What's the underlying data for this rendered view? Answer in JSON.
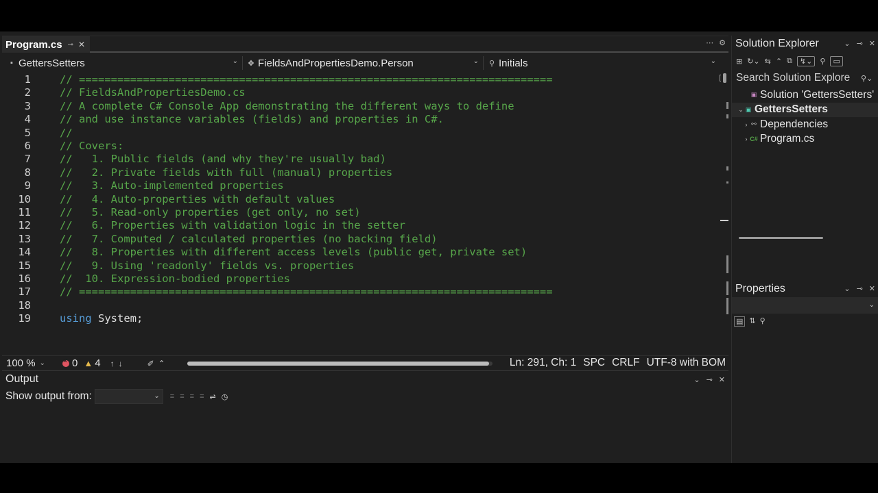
{
  "editor": {
    "tab": {
      "title": "Program.cs",
      "pin_icon": "pin-icon",
      "close_icon": "close-icon"
    },
    "nav": {
      "project": "GettersSetters",
      "type": "FieldsAndPropertiesDemo.Person",
      "member": "Initials"
    },
    "lines": [
      {
        "n": "1",
        "parts": [
          {
            "t": "// ==========================================================================",
            "c": "cm"
          }
        ]
      },
      {
        "n": "2",
        "parts": [
          {
            "t": "// FieldsAndPropertiesDemo.cs",
            "c": "cm"
          }
        ]
      },
      {
        "n": "3",
        "parts": [
          {
            "t": "// A complete C# Console App demonstrating the different ways to define",
            "c": "cm"
          }
        ]
      },
      {
        "n": "4",
        "parts": [
          {
            "t": "// and use instance variables (fields) and properties in C#.",
            "c": "cm"
          }
        ]
      },
      {
        "n": "5",
        "parts": [
          {
            "t": "//",
            "c": "cm"
          }
        ]
      },
      {
        "n": "6",
        "parts": [
          {
            "t": "// Covers:",
            "c": "cm"
          }
        ]
      },
      {
        "n": "7",
        "parts": [
          {
            "t": "//   1. Public fields (and why they're usually bad)",
            "c": "cm"
          }
        ]
      },
      {
        "n": "8",
        "parts": [
          {
            "t": "//   2. Private fields with full (manual) properties",
            "c": "cm"
          }
        ]
      },
      {
        "n": "9",
        "parts": [
          {
            "t": "//   3. Auto-implemented properties",
            "c": "cm"
          }
        ]
      },
      {
        "n": "10",
        "parts": [
          {
            "t": "//   4. Auto-properties with default values",
            "c": "cm"
          }
        ]
      },
      {
        "n": "11",
        "parts": [
          {
            "t": "//   5. Read-only properties (get only, no set)",
            "c": "cm"
          }
        ]
      },
      {
        "n": "12",
        "parts": [
          {
            "t": "//   6. Properties with validation logic in the setter",
            "c": "cm"
          }
        ]
      },
      {
        "n": "13",
        "parts": [
          {
            "t": "//   7. Computed / calculated properties (no backing field)",
            "c": "cm"
          }
        ]
      },
      {
        "n": "14",
        "parts": [
          {
            "t": "//   8. Properties with different access levels (public get, private set)",
            "c": "cm"
          }
        ]
      },
      {
        "n": "15",
        "parts": [
          {
            "t": "//   9. Using 'readonly' fields vs. properties",
            "c": "cm"
          }
        ]
      },
      {
        "n": "16",
        "parts": [
          {
            "t": "//  10. Expression-bodied properties",
            "c": "cm"
          }
        ]
      },
      {
        "n": "17",
        "parts": [
          {
            "t": "// ==========================================================================",
            "c": "cm"
          }
        ]
      },
      {
        "n": "18",
        "parts": []
      },
      {
        "n": "19",
        "parts": [
          {
            "t": "using",
            "c": "kw"
          },
          {
            "t": " System;",
            "c": "id"
          }
        ]
      }
    ],
    "status": {
      "zoom": "100 %",
      "errors": "0",
      "warnings": "4",
      "position": "Ln: 291, Ch: 1",
      "whitespace": "SPC",
      "line_endings": "CRLF",
      "encoding": "UTF-8 with BOM"
    }
  },
  "output": {
    "title": "Output",
    "show_from_label": "Show output from:",
    "source_value": ""
  },
  "solution_explorer": {
    "title": "Solution Explorer",
    "search_placeholder": "Search Solution Explore",
    "tree": [
      {
        "label": "Solution 'GettersSetters'",
        "icon": "solution-icon",
        "indent": 1,
        "expander": "",
        "bold": false,
        "selected": false
      },
      {
        "label": "GettersSetters",
        "icon": "project-icon",
        "indent": 0,
        "expander": "⌄",
        "bold": true,
        "selected": true
      },
      {
        "label": "Dependencies",
        "icon": "dependencies-icon",
        "indent": 1,
        "expander": "›",
        "bold": false,
        "selected": false
      },
      {
        "label": "Program.cs",
        "icon": "csharp-file-icon",
        "indent": 1,
        "expander": "›",
        "bold": false,
        "selected": false
      }
    ]
  },
  "properties": {
    "title": "Properties"
  },
  "colors": {
    "background": "#1f1f1f",
    "comment": "#57a64a",
    "keyword": "#569cd6",
    "error": "#e05561",
    "warning": "#e5b94c"
  }
}
